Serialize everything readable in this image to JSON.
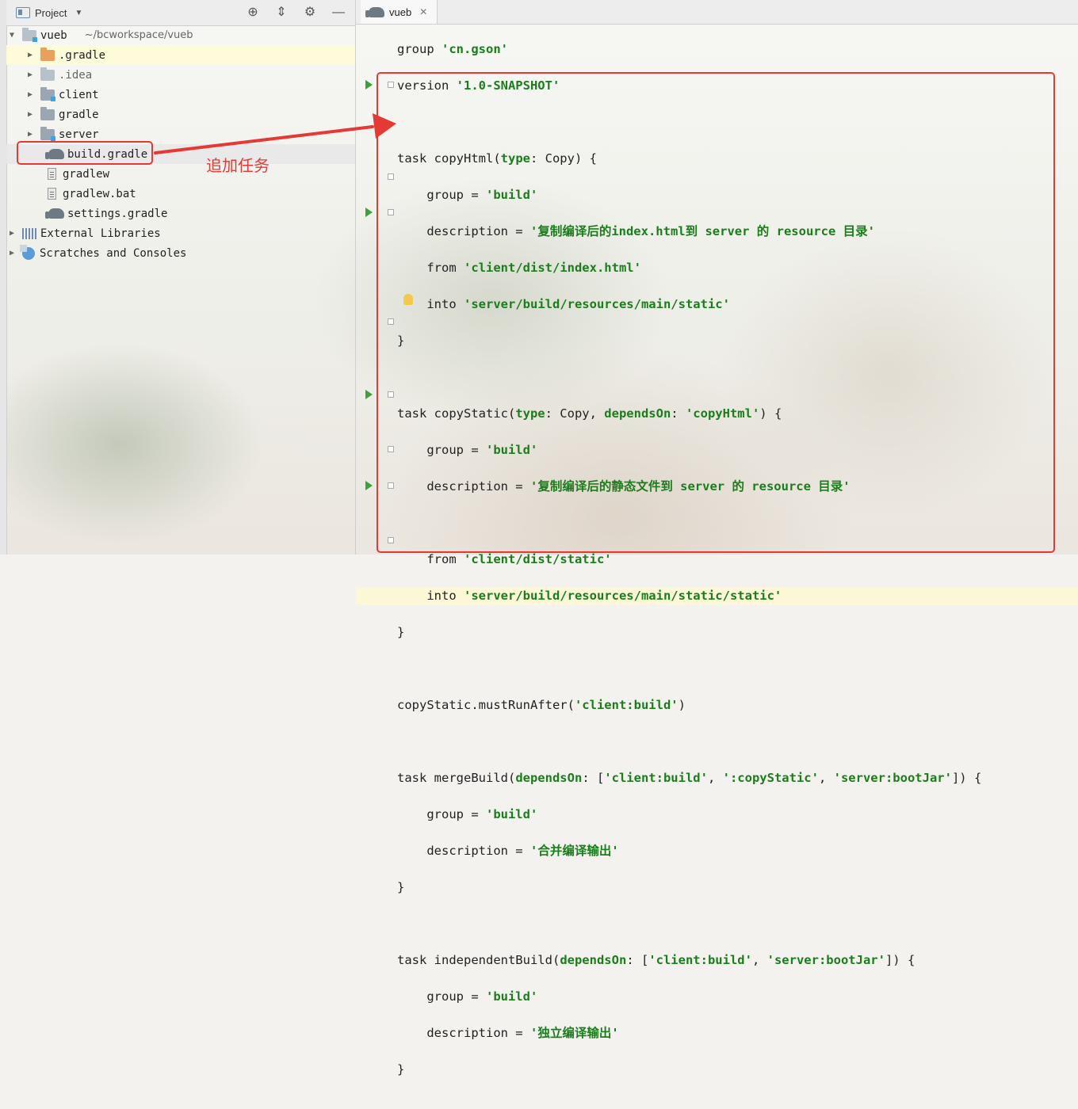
{
  "project_panel": {
    "title": "Project",
    "root": {
      "name": "vueb",
      "path": "~/bcworkspace/vueb"
    },
    "items": [
      {
        "label": ".gradle"
      },
      {
        "label": ".idea"
      },
      {
        "label": "client"
      },
      {
        "label": "gradle"
      },
      {
        "label": "server"
      },
      {
        "label": "build.gradle"
      },
      {
        "label": "gradlew"
      },
      {
        "label": "gradlew.bat"
      },
      {
        "label": "settings.gradle"
      },
      {
        "label": "External Libraries"
      },
      {
        "label": "Scratches and Consoles"
      }
    ]
  },
  "annotation": {
    "label": "追加任务",
    "color": "#e53935"
  },
  "editor": {
    "tab": {
      "label": "vueb"
    },
    "strings": {
      "cn_gson": "'cn.gson'",
      "version": "'1.0-SNAPSHOT'",
      "build": "'build'",
      "desc_html": "'复制编译后的index.html到 server 的 resource 目录'",
      "from_html": "'client/dist/index.html'",
      "into_static": "'server/build/resources/main/static'",
      "copyHtml_ref": "'copyHtml'",
      "desc_static": "'复制编译后的静态文件到 server 的 resource 目录'",
      "from_static": "'client/dist/static'",
      "into_static_static": "'server/build/resources/main/static/static'",
      "client_build": "'client:build'",
      "copyStatic_ref": "':copyStatic'",
      "server_bootJar": "'server:bootJar'",
      "desc_merge": "'合并编译输出'",
      "desc_independent": "'独立编译输出'"
    }
  }
}
